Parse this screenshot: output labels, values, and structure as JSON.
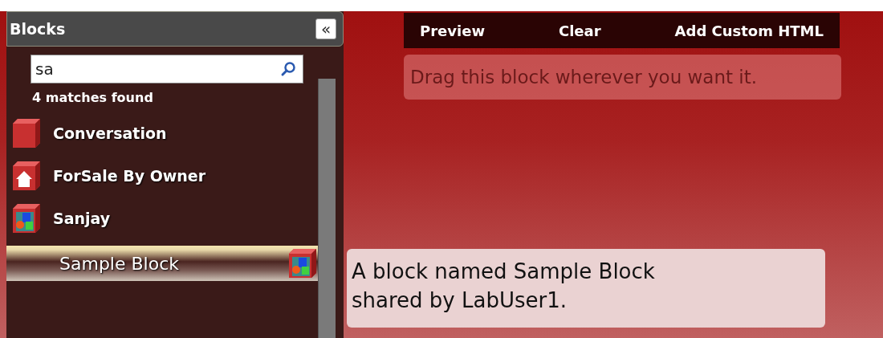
{
  "panel": {
    "title": "Blocks",
    "collapse_label": "«"
  },
  "search": {
    "value": "sa",
    "status": "4 matches found"
  },
  "blocks": [
    {
      "name": "Conversation",
      "kind": "plain",
      "selected": false
    },
    {
      "name": "ForSale By Owner",
      "kind": "house",
      "selected": false
    },
    {
      "name": "Sanjay",
      "kind": "shapes",
      "selected": false
    },
    {
      "name": "Sample Block",
      "kind": "shapes",
      "selected": true
    }
  ],
  "toolbar": [
    "Preview",
    "Clear",
    "Add Custom HTML"
  ],
  "hint": "Drag this block wherever you want it.",
  "tooltip": "A block named Sample Block shared by LabUser1."
}
